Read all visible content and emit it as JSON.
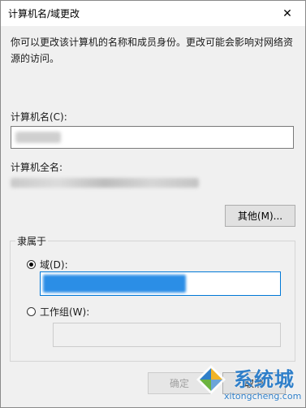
{
  "window": {
    "title": "计算机名/域更改",
    "close_glyph": "✕"
  },
  "description": "你可以更改该计算机的名称和成员身份。更改可能会影响对网络资源的访问。",
  "computer_name": {
    "label": "计算机名(C):",
    "value_redacted": true
  },
  "full_name": {
    "label": "计算机全名:",
    "value_redacted": true
  },
  "more_button": {
    "label": "其他(M)..."
  },
  "member_of": {
    "title": "隶属于",
    "domain": {
      "label": "域(D):",
      "checked": true,
      "value_redacted": true
    },
    "workgroup": {
      "label": "工作组(W):",
      "checked": false,
      "value": ""
    }
  },
  "footer": {
    "ok_label": "确定",
    "cancel_label": "取消"
  },
  "watermark": {
    "brand_cn": "系统城",
    "brand_en": "xitongcheng.com"
  },
  "colors": {
    "accent": "#0078d7",
    "selection": "#2b8ee6",
    "watermark": "#2f7fc9"
  }
}
